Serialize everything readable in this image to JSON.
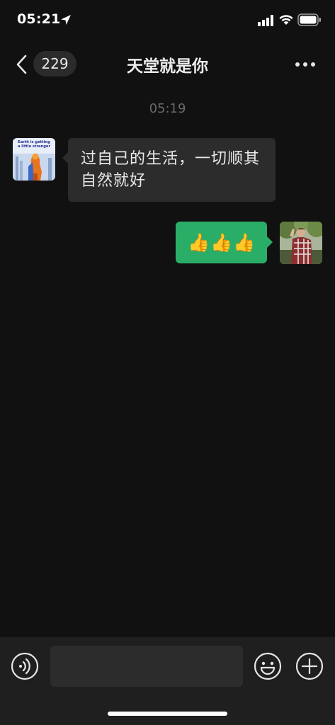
{
  "status_bar": {
    "time": "05:21",
    "icons": [
      "location-arrow-icon",
      "cellular-signal-icon",
      "wifi-icon",
      "battery-icon"
    ]
  },
  "nav": {
    "back_icon": "chevron-left-icon",
    "unread_count": "229",
    "title": "天堂就是你",
    "more_icon": "more-dots-icon"
  },
  "chat": {
    "timestamp": "05:19",
    "messages": [
      {
        "direction": "incoming",
        "avatar_text": "Earth is getting a little stranger",
        "text": "过自己的生活，一切顺其自然就好"
      },
      {
        "direction": "outgoing",
        "text": "👍👍👍"
      }
    ]
  },
  "input_bar": {
    "placeholder": "",
    "voice_icon": "voice-input-icon",
    "emoji_icon": "emoji-icon",
    "plus_icon": "plus-circle-icon"
  },
  "colors": {
    "background": "#111111",
    "incoming_bubble": "#2c2c2c",
    "outgoing_bubble": "#2aae67",
    "input_bar": "#1f1f1f"
  }
}
